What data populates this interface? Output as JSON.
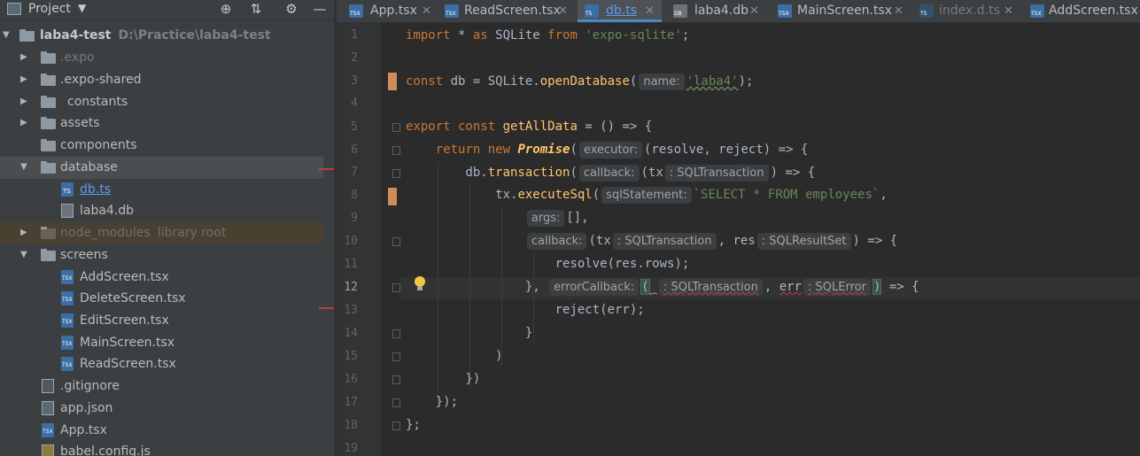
{
  "sidebar": {
    "header": {
      "title": "Project",
      "caret": "▼",
      "buttons": [
        "⊕",
        "⇅",
        "⚙",
        "—"
      ]
    },
    "tree": [
      {
        "label": "laba4-test",
        "hint": "D:\\Practice\\laba4-test",
        "type": "folder",
        "expanded": true,
        "bold": true
      },
      {
        "label": ".expo",
        "type": "folder",
        "expanded": false,
        "style": "dim"
      },
      {
        "label": ".expo-shared",
        "type": "folder",
        "expanded": false
      },
      {
        "label": "constants",
        "type": "folder",
        "expanded": false
      },
      {
        "label": "assets",
        "type": "folder",
        "expanded": false
      },
      {
        "label": "components",
        "type": "folder"
      },
      {
        "label": "database",
        "type": "folder",
        "expanded": true
      },
      {
        "label": "db.ts",
        "type": "file-ts",
        "style": "blue"
      },
      {
        "label": "laba4.db",
        "type": "file-db"
      },
      {
        "label": "node_modules",
        "hint": "library root",
        "type": "folder",
        "expanded": false,
        "style": "dimfaint"
      },
      {
        "label": "screens",
        "type": "folder",
        "expanded": true
      },
      {
        "label": "AddScreen.tsx",
        "type": "file-tsx"
      },
      {
        "label": "DeleteScreen.tsx",
        "type": "file-tsx"
      },
      {
        "label": "EditScreen.tsx",
        "type": "file-tsx"
      },
      {
        "label": "MainScreen.tsx",
        "type": "file-tsx"
      },
      {
        "label": "ReadScreen.tsx",
        "type": "file-tsx"
      },
      {
        "label": ".gitignore",
        "type": "file-git"
      },
      {
        "label": "app.json",
        "type": "file-json"
      },
      {
        "label": "App.tsx",
        "type": "file-tsx"
      },
      {
        "label": "babel.config.js",
        "type": "file-js"
      }
    ]
  },
  "tabs": [
    {
      "label": "App.tsx",
      "icon": "TSX"
    },
    {
      "label": "ReadScreen.tsx",
      "icon": "TSX"
    },
    {
      "label": "db.ts",
      "icon": "TS",
      "active": true
    },
    {
      "label": "laba4.db",
      "icon": "DB"
    },
    {
      "label": "MainScreen.tsx",
      "icon": "TSX"
    },
    {
      "label": "index.d.ts",
      "icon": "TS",
      "muted": true
    },
    {
      "label": "AddScreen.tsx",
      "icon": "TSX"
    }
  ],
  "close_glyph": "✕",
  "editor": {
    "line_numbers": [
      "1",
      "2",
      "3",
      "4",
      "5",
      "6",
      "7",
      "8",
      "9",
      "10",
      "11",
      "12",
      "13",
      "14",
      "15",
      "16",
      "17",
      "18",
      "19"
    ],
    "current_line": "12",
    "hints": {
      "name": "name:",
      "executor": "executor:",
      "callback": "callback:",
      "tx_type": ": SQLTransaction",
      "sqlStatement": "sqlStatement:",
      "args": "args:",
      "callback2": "callback:",
      "tx_type2": ": SQLTransaction",
      "res_type": ": SQLResultSet",
      "errorCallback": "errorCallback:",
      "tx_type3": ": SQLTransaction",
      "err_type": ": SQLError"
    }
  }
}
